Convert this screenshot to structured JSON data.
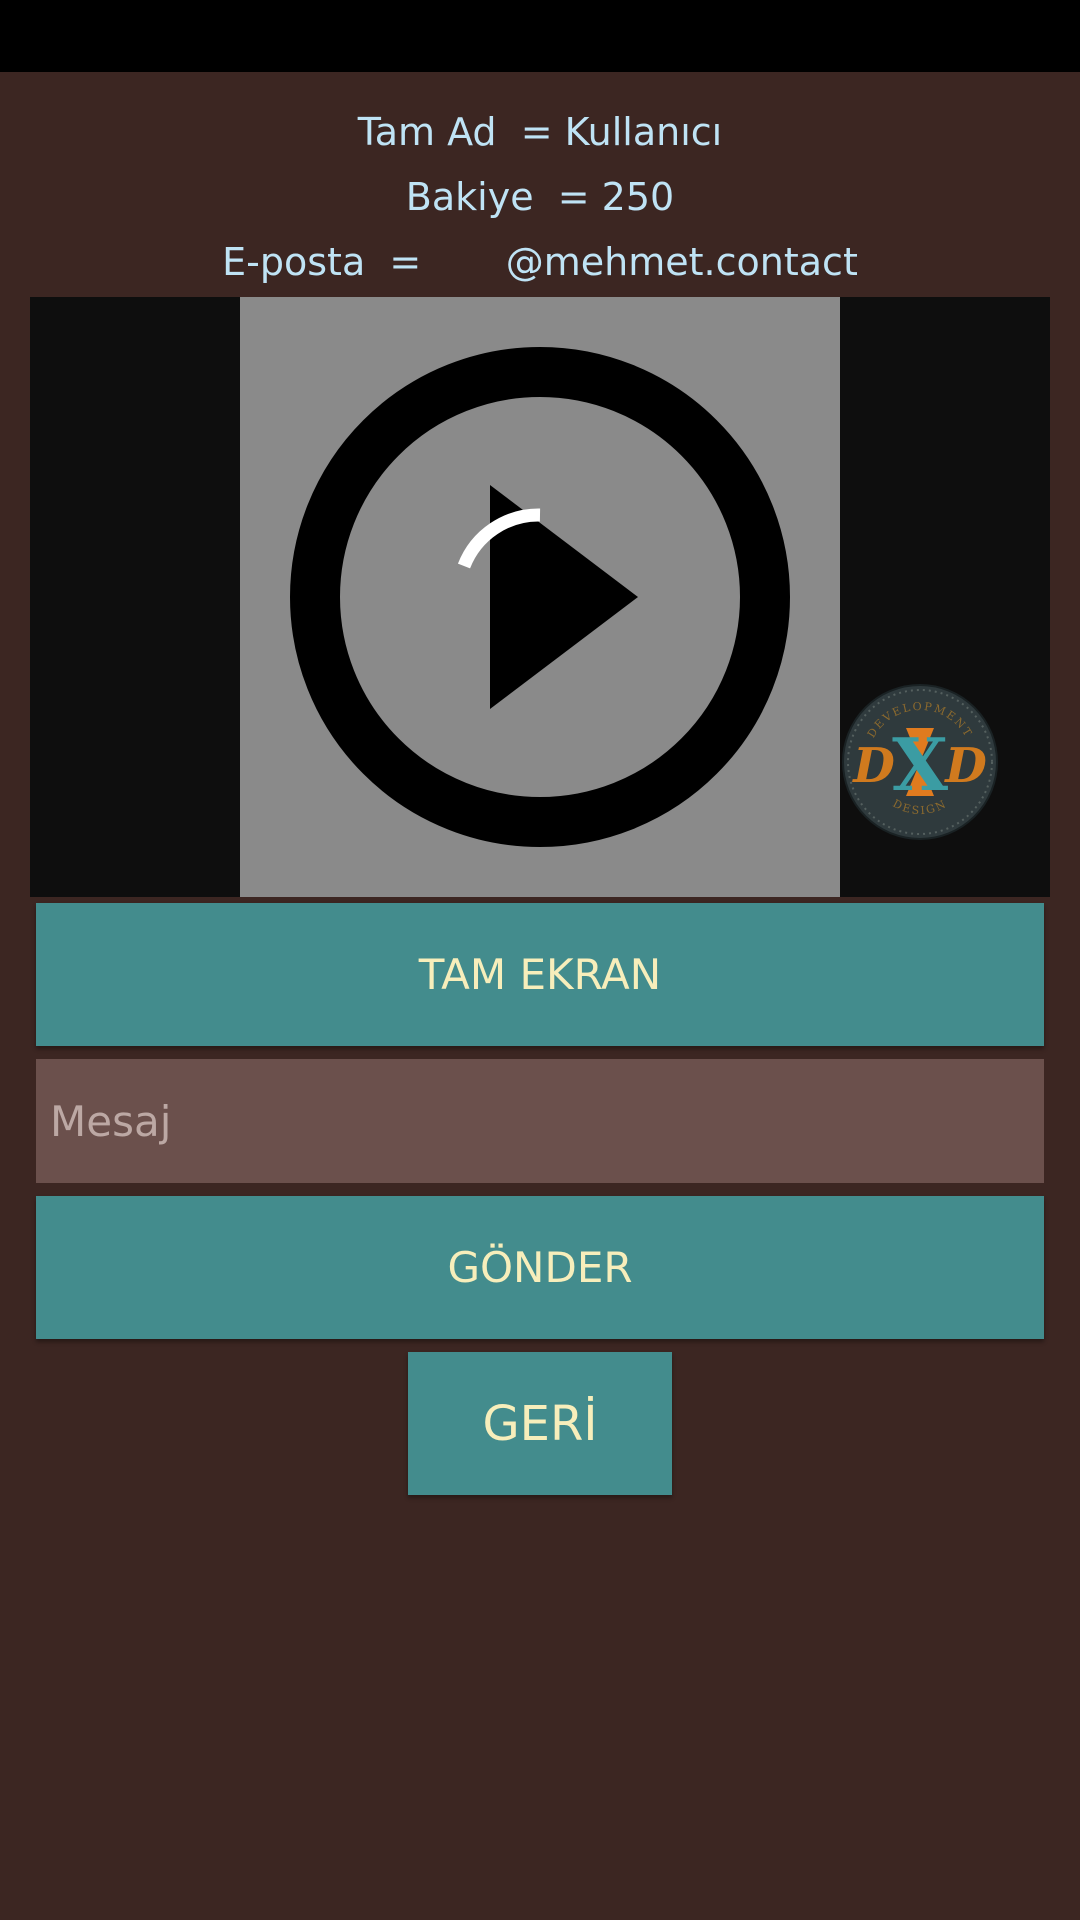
{
  "user_info": {
    "name_line": "Tam Ad  = Kullanıcı",
    "balance_line": "Bakiye  = 250",
    "email_line": "E-posta  =       @mehmet.contact"
  },
  "video": {
    "icon": "play-circle-icon",
    "loading_indicator": "spinner-icon",
    "watermark_text_top": "DEVELOPMENT",
    "watermark_text_bottom": "DESIGN",
    "watermark_letters": "DXD"
  },
  "buttons": {
    "fullscreen_label": "TAM EKRAN",
    "send_label": "GÖNDER",
    "back_label": "GERİ"
  },
  "message": {
    "placeholder": "Mesaj",
    "value": ""
  },
  "colors": {
    "background": "#3c2622",
    "button": "#438c8d",
    "button_text": "#f7eebb",
    "info_text": "#bfe3f5",
    "input_bg": "#6b504c"
  }
}
